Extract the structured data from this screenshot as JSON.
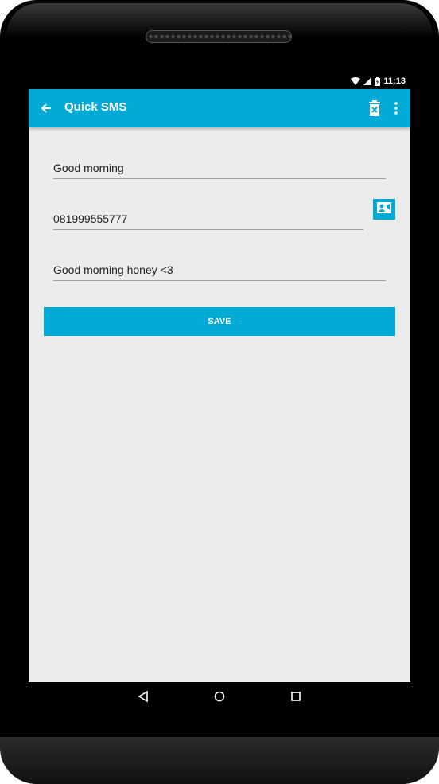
{
  "status_bar": {
    "time": "11:13",
    "icons": [
      "wifi-icon",
      "signal-icon",
      "battery-icon"
    ]
  },
  "app_bar": {
    "title": "Quick SMS",
    "actions": [
      "back-arrow-icon",
      "delete-icon",
      "more-vert-icon"
    ]
  },
  "form": {
    "title_value": "Good morning",
    "phone_value": "081999555777",
    "message_value": "Good morning honey <3",
    "contact_picker_icon": "contact-card-icon",
    "save_label": "SAVE"
  },
  "nav_bar": {
    "buttons": [
      "back-triangle-icon",
      "home-circle-icon",
      "recents-square-icon"
    ]
  },
  "colors": {
    "accent": "#03aad6",
    "background": "#ececec",
    "device": "#000000"
  }
}
